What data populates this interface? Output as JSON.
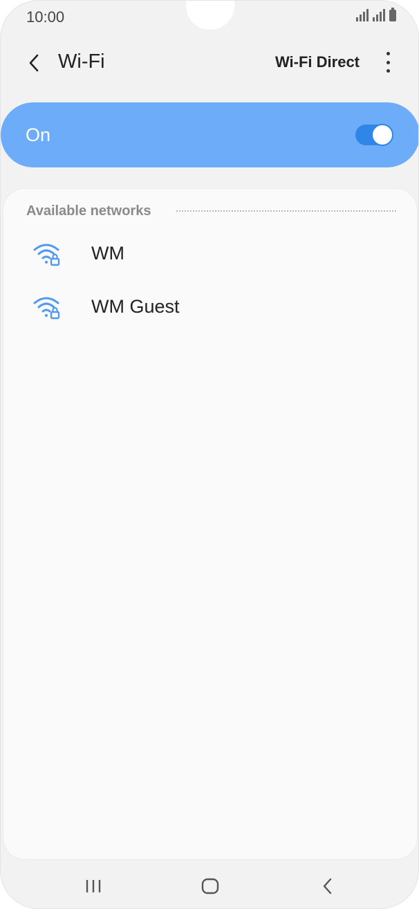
{
  "status_bar": {
    "time": "10:00"
  },
  "app_bar": {
    "back_icon": "chevron-left-icon",
    "title": "Wi-Fi",
    "wifi_direct_label": "Wi-Fi Direct",
    "more_icon": "more-vertical-icon"
  },
  "wifi_toggle": {
    "label": "On",
    "state": "on",
    "accent_color": "#6dacf8"
  },
  "networks": {
    "header": "Available networks",
    "items": [
      {
        "name": "WM",
        "icon": "wifi-lock-icon",
        "secured": true
      },
      {
        "name": "WM Guest",
        "icon": "wifi-lock-icon",
        "secured": true
      }
    ]
  },
  "nav_bar": {
    "recents_icon": "recents-icon",
    "home_icon": "home-icon",
    "back_icon": "back-icon"
  }
}
